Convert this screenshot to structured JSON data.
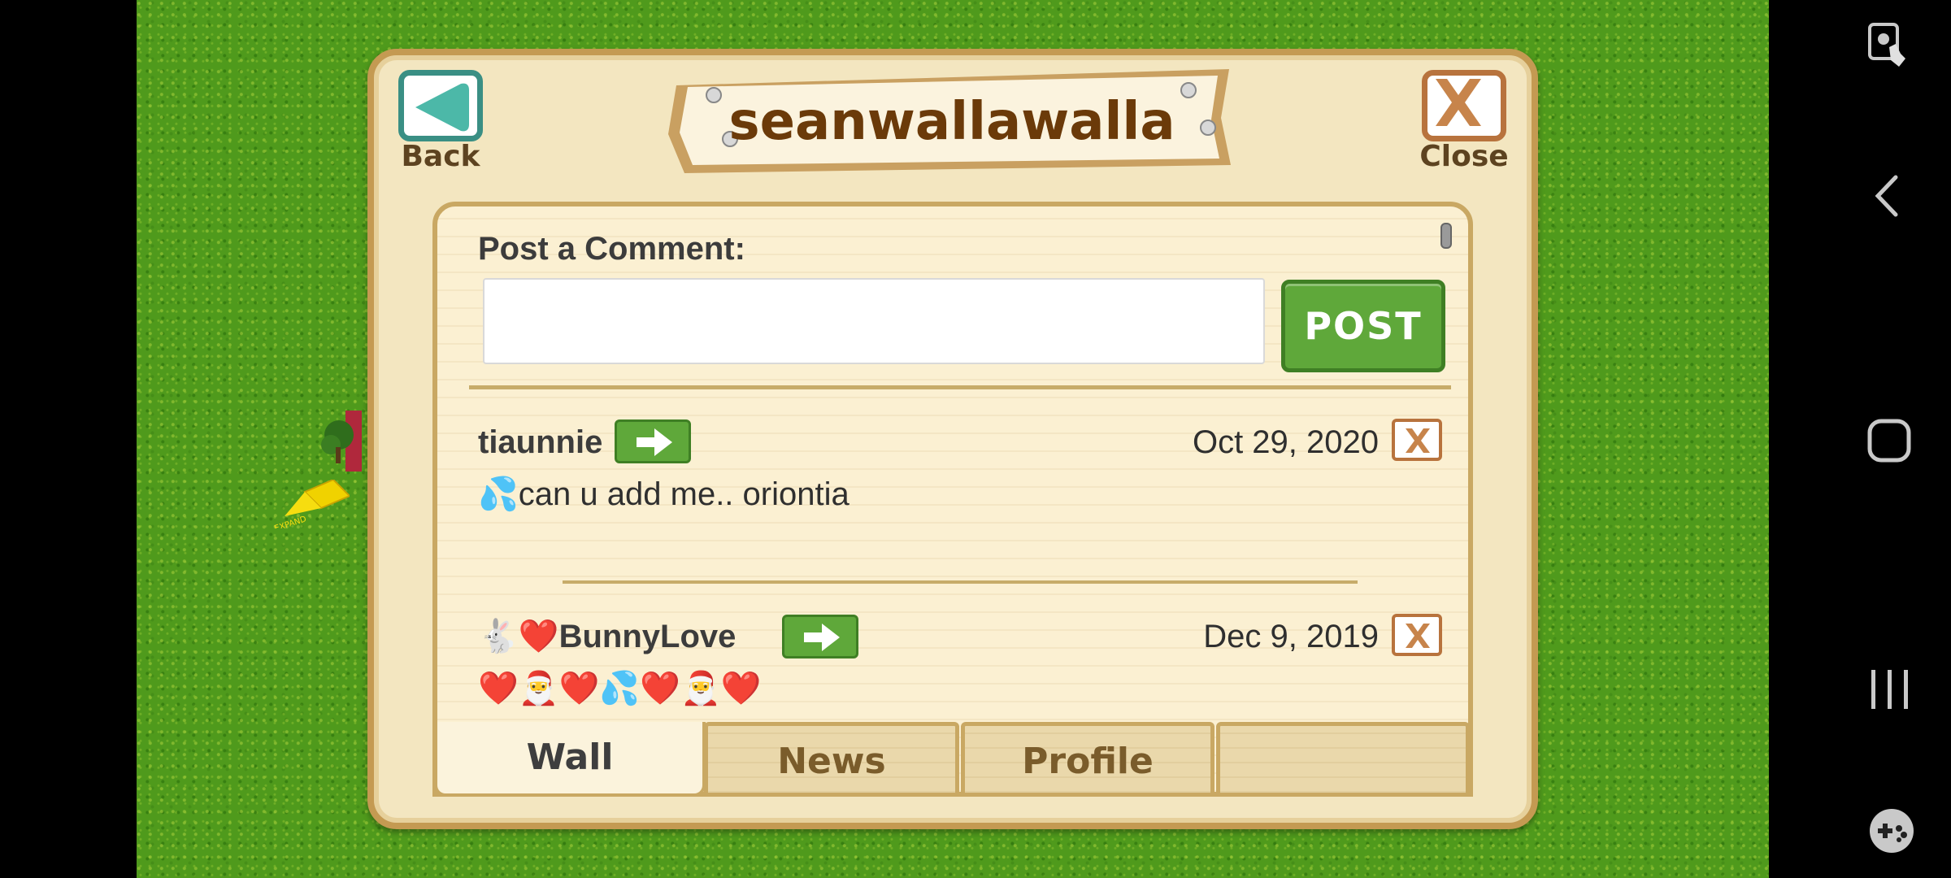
{
  "dialog": {
    "title": "seanwallawalla",
    "back_label": "Back",
    "close_label": "Close"
  },
  "composer": {
    "label": "Post a Comment:",
    "input_value": "",
    "post_button": "POST"
  },
  "comments": [
    {
      "author": "tiaunnie",
      "date": "Oct 29, 2020",
      "text": "💦can u add me.. oriontia"
    },
    {
      "author": "🐇❤️BunnyLove",
      "date": "Dec 9, 2019",
      "text": "❤️🎅❤️💦❤️🎅❤️"
    }
  ],
  "tabs": [
    {
      "label": "Wall",
      "active": true
    },
    {
      "label": "News",
      "active": false
    },
    {
      "label": "Profile",
      "active": false
    },
    {
      "label": "",
      "active": false
    }
  ],
  "colors": {
    "grass": "#4f9a1c",
    "panel_bg": "#f3e6c0",
    "panel_border": "#c49a52",
    "post_green": "#5fa83a",
    "close_brown": "#b8733d",
    "back_teal": "#3a8f84",
    "title_brown": "#6b3a09"
  },
  "icons": {
    "back": "back-arrow-icon",
    "close": "close-x-icon",
    "go": "right-arrow-icon",
    "delete": "delete-x-icon",
    "system_top": "screenshot-touch-icon",
    "nav_back": "android-back-icon",
    "nav_home": "android-home-icon",
    "nav_recents": "android-recents-icon",
    "game_tools": "gamepad-icon"
  }
}
